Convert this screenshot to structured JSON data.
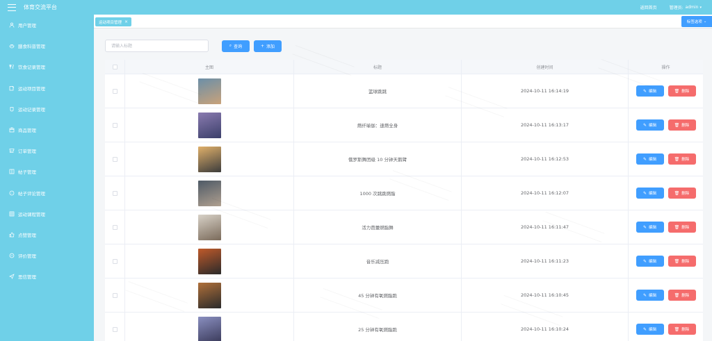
{
  "header": {
    "app_title": "体育交流平台",
    "home_link": "返回首页",
    "user_label": "管理员:",
    "user_name": "admin"
  },
  "sidebar": {
    "items": [
      {
        "label": "用户管理",
        "icon": "user-icon"
      },
      {
        "label": "膳食科普管理",
        "icon": "bowl-icon"
      },
      {
        "label": "饮食记录管理",
        "icon": "fork-knife-icon"
      },
      {
        "label": "运动项目管理",
        "icon": "edit-icon"
      },
      {
        "label": "运动记录管理",
        "icon": "cup-icon"
      },
      {
        "label": "商品管理",
        "icon": "box-icon"
      },
      {
        "label": "订单管理",
        "icon": "cart-icon"
      },
      {
        "label": "帖子管理",
        "icon": "book-icon"
      },
      {
        "label": "帖子评论管理",
        "icon": "chat-icon"
      },
      {
        "label": "运动课程管理",
        "icon": "grid-icon"
      },
      {
        "label": "点赞管理",
        "icon": "thumb-up-icon"
      },
      {
        "label": "评价管理",
        "icon": "comment-icon"
      },
      {
        "label": "思信管理",
        "icon": "send-icon"
      }
    ]
  },
  "tags": {
    "active_tag": "运动项目管理",
    "close": "×",
    "options_label": "标签选项"
  },
  "toolbar": {
    "search_placeholder": "请输入标题",
    "query_label": "查询",
    "add_label": "添加"
  },
  "table": {
    "headers": {
      "image": "主图",
      "title": "标题",
      "created": "创建时间",
      "ops": "操作"
    },
    "edit_label": "编辑",
    "delete_label": "删除",
    "rows": [
      {
        "title": "篮球跳跳",
        "created": "2024-10-11 16:14:19",
        "thumb": [
          "#6b8fa8",
          "#c9a27a"
        ]
      },
      {
        "title": "燃纤瑜伽：速燃全身",
        "created": "2024-10-11 16:13:17",
        "thumb": [
          "#8a7bb0",
          "#3b3f6a"
        ]
      },
      {
        "title": "俄罗斯舞团级 10 分钟天鹅臂",
        "created": "2024-10-11 16:12:53",
        "thumb": [
          "#e0b06a",
          "#3c3c3c"
        ]
      },
      {
        "title": "1000 次跳跳燃脂",
        "created": "2024-10-11 16:12:07",
        "thumb": [
          "#4e5a66",
          "#b0a090"
        ]
      },
      {
        "title": "活力芭蕾燃脂舞",
        "created": "2024-10-11 16:11:47",
        "thumb": [
          "#d8d2c8",
          "#7a6a5a"
        ]
      },
      {
        "title": "音乐减压跑",
        "created": "2024-10-11 16:11:23",
        "thumb": [
          "#c05a2a",
          "#2a2a2a"
        ]
      },
      {
        "title": "45 分钟有氧燃脂跑",
        "created": "2024-10-11 16:10:45",
        "thumb": [
          "#b0703a",
          "#2a2a2a"
        ]
      },
      {
        "title": "25 分钟有氧燃脂跑",
        "created": "2024-10-11 16:10:24",
        "thumb": [
          "#8a8fc0",
          "#3a3a5a"
        ]
      }
    ]
  },
  "colors": {
    "brand": "#6fd0e8",
    "primary": "#409eff",
    "danger": "#f56c6c"
  }
}
